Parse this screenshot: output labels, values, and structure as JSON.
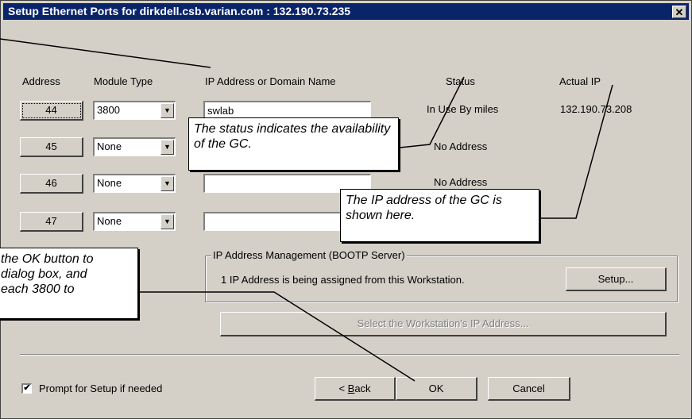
{
  "window": {
    "title": "Setup Ethernet Ports for dirkdell.csb.varian.com : 132.190.73.235",
    "close_icon": "close-icon"
  },
  "columns": {
    "address": "Address",
    "module_type": "Module Type",
    "ip": "IP Address or Domain Name",
    "status": "Status",
    "actual_ip": "Actual IP"
  },
  "rows": [
    {
      "address": "44",
      "module_type": "3800",
      "ip": "swlab",
      "status": "In Use By miles",
      "actual_ip": "132.190.73.208"
    },
    {
      "address": "45",
      "module_type": "None",
      "ip": "",
      "status": "No Address",
      "actual_ip": ""
    },
    {
      "address": "46",
      "module_type": "None",
      "ip": "",
      "status": "No Address",
      "actual_ip": ""
    },
    {
      "address": "47",
      "module_type": "None",
      "ip": "",
      "status": "",
      "actual_ip": ""
    }
  ],
  "ip_management": {
    "group_label": "IP Address Management (BOOTP Server)",
    "info": "1 IP Address is being assigned from this Workstation.",
    "setup_button": "Setup...",
    "select_ip_button": "Select the Workstation's IP Address..."
  },
  "prompt_checkbox": {
    "label": "Prompt for Setup if needed",
    "checked": true,
    "mark": "✔"
  },
  "buttons": {
    "back": "< Back",
    "back_mnemonic": "B",
    "ok": "OK",
    "cancel": "Cancel"
  },
  "callouts": {
    "status": "The status indicates the availability of the GC.",
    "actual_ip": "The IP address of the GC is shown here.",
    "ok_line1": "the OK button to",
    "ok_line2": "dialog box, and",
    "ok_line3": "each 3800 to"
  }
}
